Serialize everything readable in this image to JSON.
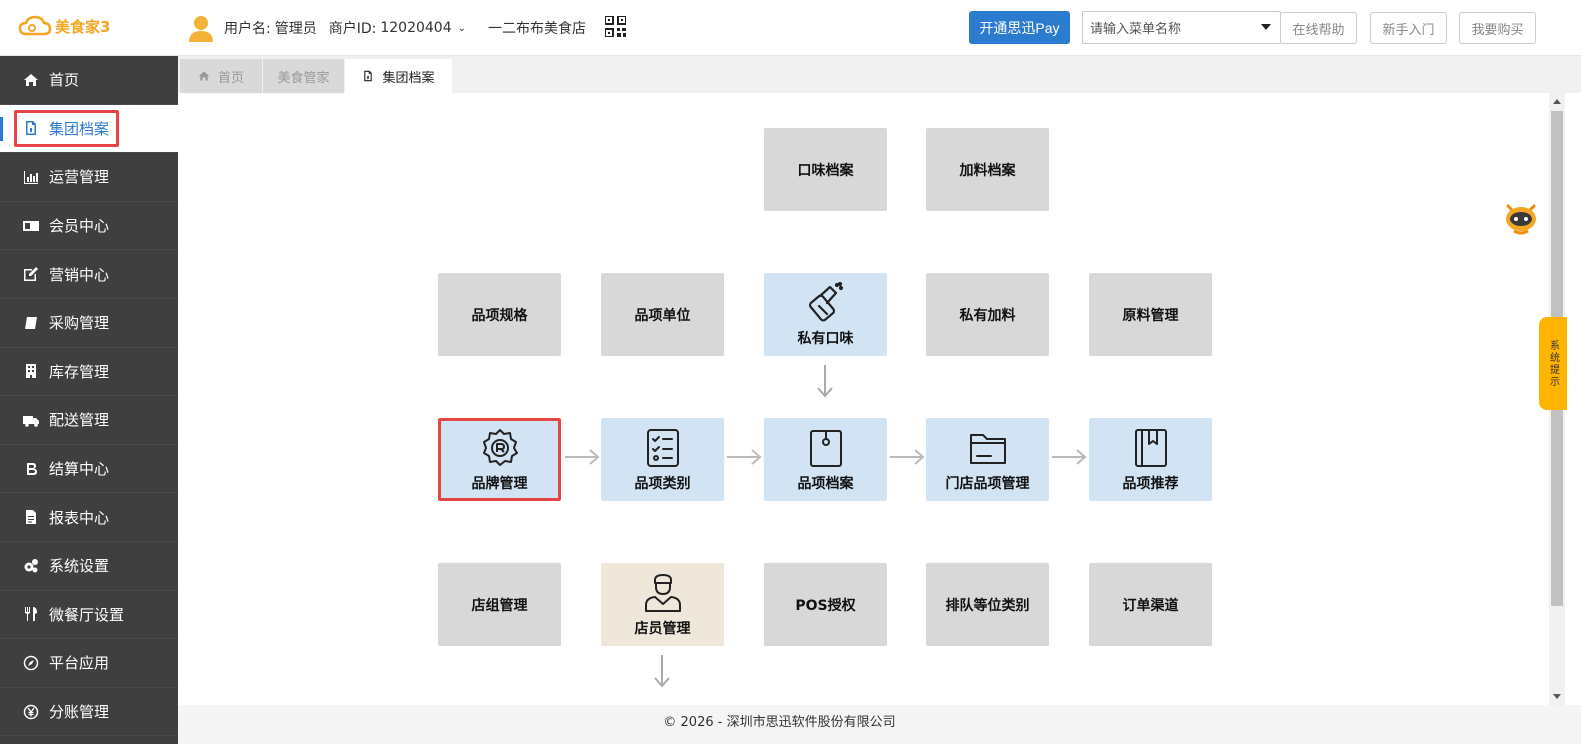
{
  "header": {
    "logo_text": "美食家3",
    "user_label": "用户名:",
    "user_name": "管理员",
    "merchant_label": "商户ID:",
    "merchant_id": "12020404",
    "store_name": "一二布布美食店",
    "pay_button": "开通思迅Pay",
    "menu_search_placeholder": "请输入菜单名称",
    "online_help": "在线帮助",
    "beginner": "新手入门",
    "buy": "我要购买"
  },
  "sidebar": {
    "items": [
      {
        "label": "首页",
        "icon": "home-icon"
      },
      {
        "label": "集团档案",
        "icon": "file-icon",
        "active": true
      },
      {
        "label": "运营管理",
        "icon": "bar-chart-icon"
      },
      {
        "label": "会员中心",
        "icon": "id-card-icon"
      },
      {
        "label": "营销中心",
        "icon": "edit-icon"
      },
      {
        "label": "采购管理",
        "icon": "book-icon"
      },
      {
        "label": "库存管理",
        "icon": "building-icon"
      },
      {
        "label": "配送管理",
        "icon": "truck-icon"
      },
      {
        "label": "结算中心",
        "icon": "bitcoin-icon"
      },
      {
        "label": "报表中心",
        "icon": "report-icon"
      },
      {
        "label": "系统设置",
        "icon": "gears-icon"
      },
      {
        "label": "微餐厅设置",
        "icon": "cutlery-icon"
      },
      {
        "label": "平台应用",
        "icon": "compass-icon"
      },
      {
        "label": "分账管理",
        "icon": "yen-icon"
      }
    ]
  },
  "tabs": [
    {
      "label": "首页"
    },
    {
      "label": "美食管家"
    },
    {
      "label": "集团档案",
      "active": true
    }
  ],
  "flow": {
    "taste": "口味档案",
    "addon": "加料档案",
    "spec": "品项规格",
    "unit": "品项单位",
    "private_taste": "私有口味",
    "private_addon": "私有加料",
    "material": "原料管理",
    "brand": "品牌管理",
    "category": "品项类别",
    "item_archive": "品项档案",
    "store_item": "门店品项管理",
    "recommend": "品项推荐",
    "store_group": "店组管理",
    "staff": "店员管理",
    "pos_auth": "POS授权",
    "queue_type": "排队等位类别",
    "order_channel": "订单渠道"
  },
  "footer": {
    "copyright": "© 2026 - 深圳市思迅软件股份有限公司"
  },
  "system_tip": "系统提示",
  "colors": {
    "accent": "#2b7bce",
    "highlight": "#e64545",
    "sidebar_bg": "#3f3f3f",
    "box_grey": "#d8d8d8",
    "box_blue": "#d2e3f4",
    "box_beige": "#efe7da",
    "tip": "#ffb400"
  }
}
